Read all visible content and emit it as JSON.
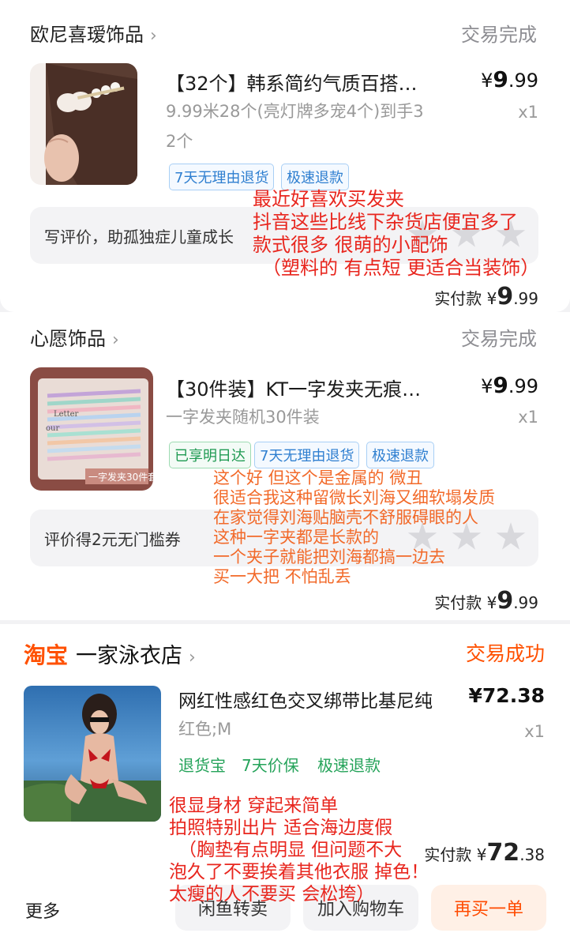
{
  "orders": [
    {
      "shop": "欧尼喜瑷饰品",
      "status": "交易完成",
      "product_title": "【32个】韩系简约气质百搭…",
      "price_symbol": "¥",
      "price_int": "9",
      "price_dec": ".99",
      "qty": "x1",
      "spec_line1": "9.99米28个(亮灯牌多宠4个)到手3",
      "spec_line2": "2个",
      "tags": [
        "7天无理由退货",
        "极速退款"
      ],
      "review_prompt": "写评价，助孤独症儿童成长",
      "paid_label": "实付款",
      "paid_symbol": "¥",
      "paid_int": "9",
      "paid_dec": ".99",
      "annotation": [
        "最近好喜欢买发夹",
        "抖音这些比线下杂货店便宜多了",
        "款式很多 很萌的小配饰",
        "（塑料的 有点短 更适合当装饰）"
      ]
    },
    {
      "shop": "心愿饰品",
      "status": "交易完成",
      "product_title": "【30件装】KT一字发夹无痕…",
      "price_symbol": "¥",
      "price_int": "9",
      "price_dec": ".99",
      "qty": "x1",
      "spec_line1": "一字发夹随机30件装",
      "tags": [
        "已享明日达",
        "7天无理由退货",
        "极速退款"
      ],
      "review_prompt": "评价得2元无门槛券",
      "paid_label": "实付款",
      "paid_symbol": "¥",
      "paid_int": "9",
      "paid_dec": ".99",
      "annotation": [
        "这个好 但这个是金属的 微丑",
        "很适合我这种留微长刘海又细软塌发质",
        "在家觉得刘海贴脑壳不舒服碍眼的人",
        "这种一字夹都是长款的",
        "一个夹子就能把刘海都搞一边去",
        "买一大把 不怕乱丢"
      ]
    },
    {
      "platform": "淘宝",
      "shop": "一家泳衣店",
      "status": "交易成功",
      "product_title": "网红性感红色交叉绑带比基尼纯",
      "price": "¥72.38",
      "qty": "x1",
      "spec_line1": "红色;M",
      "services": [
        "退货宝",
        "7天价保",
        "极速退款"
      ],
      "paid_label": "实付款",
      "paid_symbol": "¥",
      "paid_int": "72",
      "paid_dec": ".38",
      "annotation": [
        "很显身材 穿起来简单",
        "拍照特别出片 适合海边度假",
        "（胸垫有点明显 但问题不大",
        "泡久了不要挨着其他衣服 掉色！",
        "太瘦的人不要买 会松垮）"
      ]
    }
  ],
  "footer": {
    "more": "更多",
    "buttons": [
      "闲鱼转卖",
      "加入购物车",
      "再买一单"
    ]
  },
  "thumb2_text": "一字发夹30件套",
  "colors": {
    "taobao_orange": "#ff5000",
    "annotation_red": "#e8261e",
    "annotation_orange": "#f26a2a",
    "service_green": "#25a35a",
    "tag_blue": "#2f7fd0"
  }
}
